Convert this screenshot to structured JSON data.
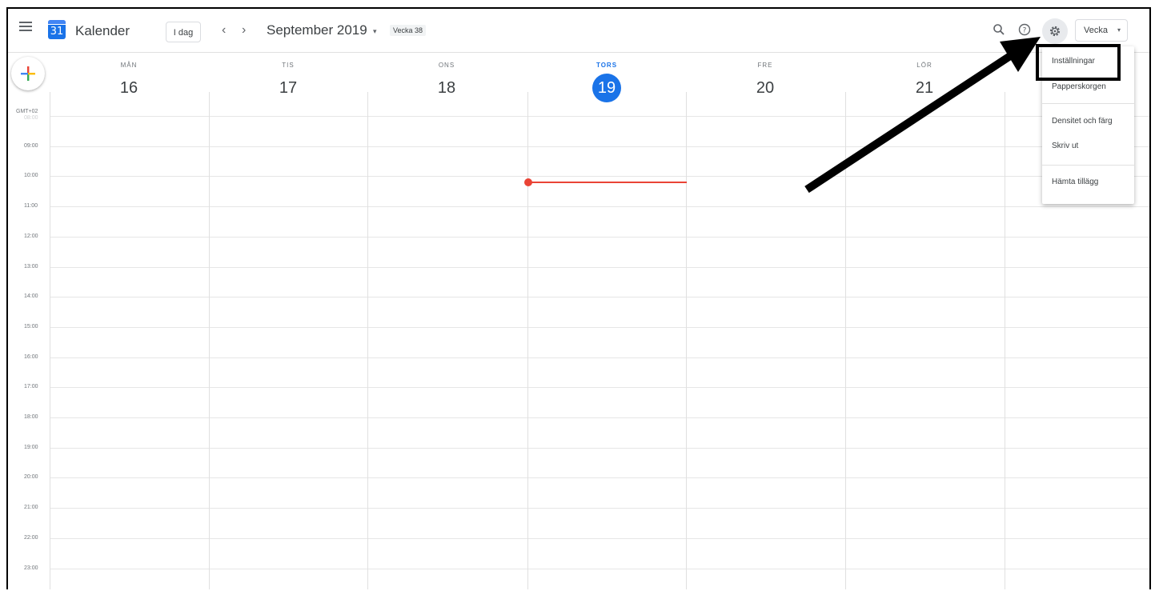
{
  "header": {
    "app_title": "Kalender",
    "logo_number": "31",
    "today_label": "I dag",
    "prev_label": "‹",
    "next_label": "›",
    "month_title": "September 2019",
    "month_caret": "▾",
    "week_badge": "Vecka 38",
    "view_label": "Vecka",
    "view_caret": "▾"
  },
  "icons": [
    "menu-icon",
    "search-icon",
    "help-icon",
    "gear-icon",
    "more-vert-icon",
    "plus-icon"
  ],
  "days": [
    {
      "name": "MÅN",
      "num": "16"
    },
    {
      "name": "TIS",
      "num": "17"
    },
    {
      "name": "ONS",
      "num": "18"
    },
    {
      "name": "TORS",
      "num": "19"
    },
    {
      "name": "FRE",
      "num": "20"
    },
    {
      "name": "LÖR",
      "num": "21"
    }
  ],
  "timezone": "GMT+02",
  "hours": [
    "08:00",
    "09:00",
    "10:00",
    "11:00",
    "12:00",
    "13:00",
    "14:00",
    "15:00",
    "16:00",
    "17:00",
    "18:00",
    "19:00",
    "20:00",
    "21:00",
    "22:00",
    "23:00"
  ],
  "settings_menu": {
    "items": [
      "Inställningar",
      "Papperskorgen",
      "Densitet och färg",
      "Skriv ut",
      "Hämta tillägg"
    ]
  },
  "colors": {
    "accent": "#1a73e8",
    "now_indicator": "#ea4335",
    "annotation": "#000000"
  }
}
